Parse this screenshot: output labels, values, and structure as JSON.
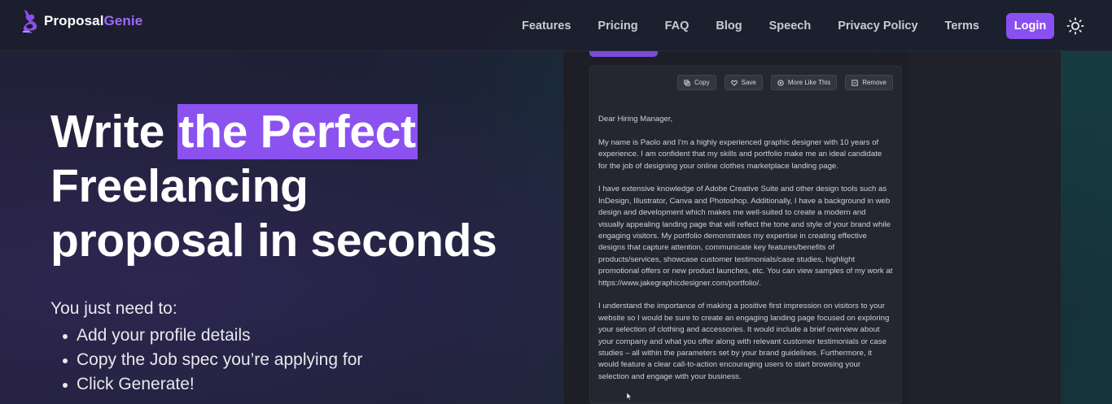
{
  "brand": {
    "name_part1": "Proposal",
    "name_part2": "Genie",
    "accent_color": "#9b6bff"
  },
  "nav": {
    "links": [
      "Features",
      "Pricing",
      "FAQ",
      "Blog",
      "Speech",
      "Privacy Policy",
      "Terms"
    ],
    "login_label": "Login",
    "theme_toggle_icon": "sun-icon"
  },
  "hero": {
    "headline_part1": "Write ",
    "headline_highlight": "the Perfect",
    "headline_line2": "Freelancing",
    "headline_line3": "proposal in seconds",
    "highlight_color": "#8b52f0",
    "subheading": "You just need to:",
    "steps": [
      "Add your profile details",
      "Copy the Job spec you’re applying for",
      "Click Generate!"
    ]
  },
  "mockup": {
    "actions": [
      {
        "label": "Copy",
        "icon": "copy-icon"
      },
      {
        "label": "Save",
        "icon": "heart-icon"
      },
      {
        "label": "More Like This",
        "icon": "plus-circle-icon"
      },
      {
        "label": "Remove",
        "icon": "minus-square-icon"
      }
    ],
    "letter": {
      "greeting": "Dear Hiring Manager,",
      "paragraphs": [
        "My name is Paolo and I'm a highly experienced graphic designer with 10 years of experience. I am confident that my skills and portfolio make me an ideal candidate for the job of designing your online clothes marketplace landing page.",
        "I have extensive knowledge of Adobe Creative Suite and other design tools such as InDesign, Illustrator, Canva and Photoshop. Additionally, I have a background in web design and development which makes me well-suited to create a modern and visually appealing landing page that will reflect the tone and style of your brand while engaging visitors. My portfolio demonstrates my expertise in creating effective designs that capture attention, communicate key features/benefits of products/services, showcase customer testimonials/case studies, highlight promotional offers or new product launches, etc. You can view samples of my work at https://www.jakegraphicdesigner.com/portfolio/.",
        "I understand the importance of making a positive first impression on visitors to your website so I would be sure to create an engaging landing page focused on exploring your selection of clothing and accessories. It would include a brief overview about your company and what you offer along with relevant customer testimonials or case studies – all within the parameters set by your brand guidelines. Furthermore, it would feature a clear call-to-action encouraging users to start browsing your selection and engage with your business."
      ]
    }
  }
}
